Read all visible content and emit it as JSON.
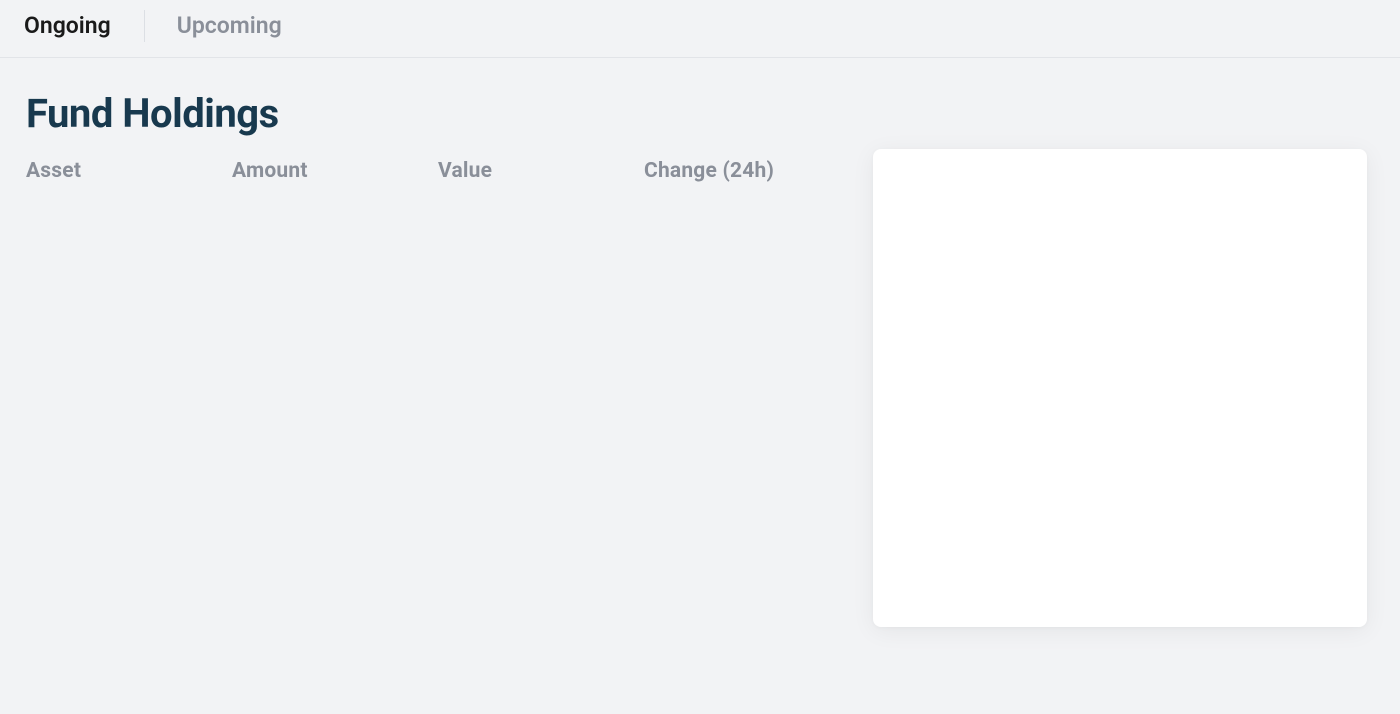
{
  "tabs": {
    "ongoing": "Ongoing",
    "upcoming": "Upcoming"
  },
  "page_title": "Fund Holdings",
  "table": {
    "headers": {
      "asset": "Asset",
      "amount": "Amount",
      "value": "Value",
      "change": "Change (24h)"
    }
  }
}
